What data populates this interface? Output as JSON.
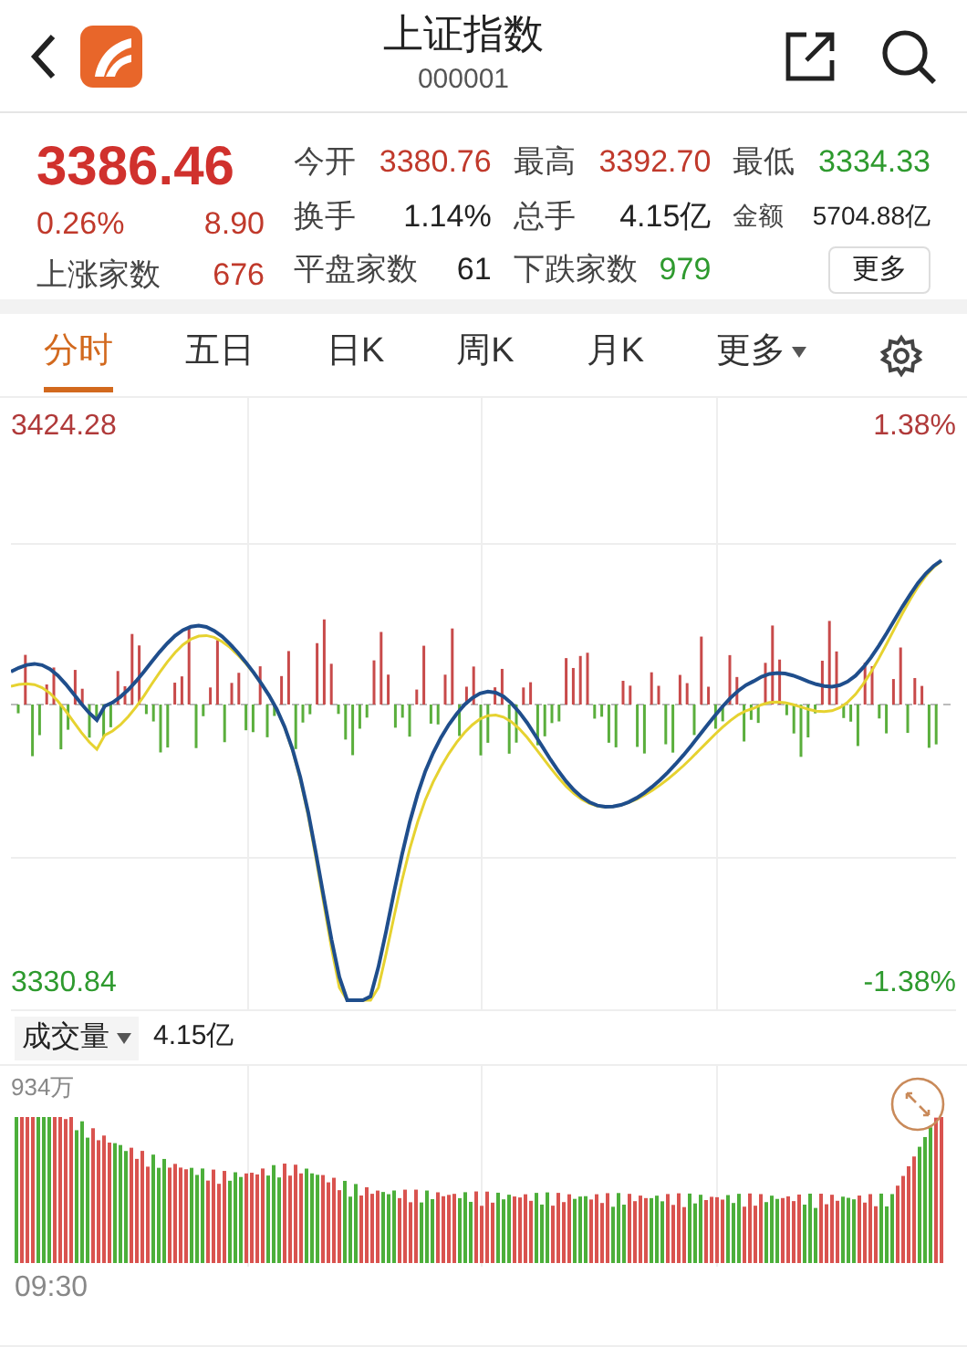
{
  "header": {
    "title": "上证指数",
    "code": "000001"
  },
  "quote": {
    "price": "3386.46",
    "change_pct": "0.26%",
    "change": "8.90",
    "rise_label": "上涨家数",
    "rise_count": "676"
  },
  "stats": [
    {
      "label": "今开",
      "value": "3380.76",
      "kind": "up"
    },
    {
      "label": "最高",
      "value": "3392.70",
      "kind": "up"
    },
    {
      "label": "最低",
      "value": "3334.33",
      "kind": "down"
    },
    {
      "label": "换手",
      "value": "1.14%",
      "kind": "flat"
    },
    {
      "label": "总手",
      "value": "4.15亿",
      "kind": "flat"
    },
    {
      "label": "金额",
      "value": "5704.88亿",
      "kind": "small"
    },
    {
      "label": "平盘家数",
      "value": "61",
      "kind": "flat"
    },
    {
      "label": "下跌家数",
      "value": "979",
      "kind": "down"
    }
  ],
  "more_button": "更多",
  "tabs": [
    {
      "label": "分时",
      "selected": true
    },
    {
      "label": "五日",
      "selected": false
    },
    {
      "label": "日K",
      "selected": false
    },
    {
      "label": "周K",
      "selected": false
    },
    {
      "label": "月K",
      "selected": false
    },
    {
      "label": "更多",
      "selected": false,
      "kind": "dropdown"
    }
  ],
  "price_chart": {
    "top_price": "3424.28",
    "top_pct": "1.38%",
    "bottom_price": "3330.84",
    "bottom_pct": "-1.38%"
  },
  "volume": {
    "selector": "成交量",
    "total": "4.15亿",
    "max_label": "934万",
    "time_start": "09:30"
  }
}
